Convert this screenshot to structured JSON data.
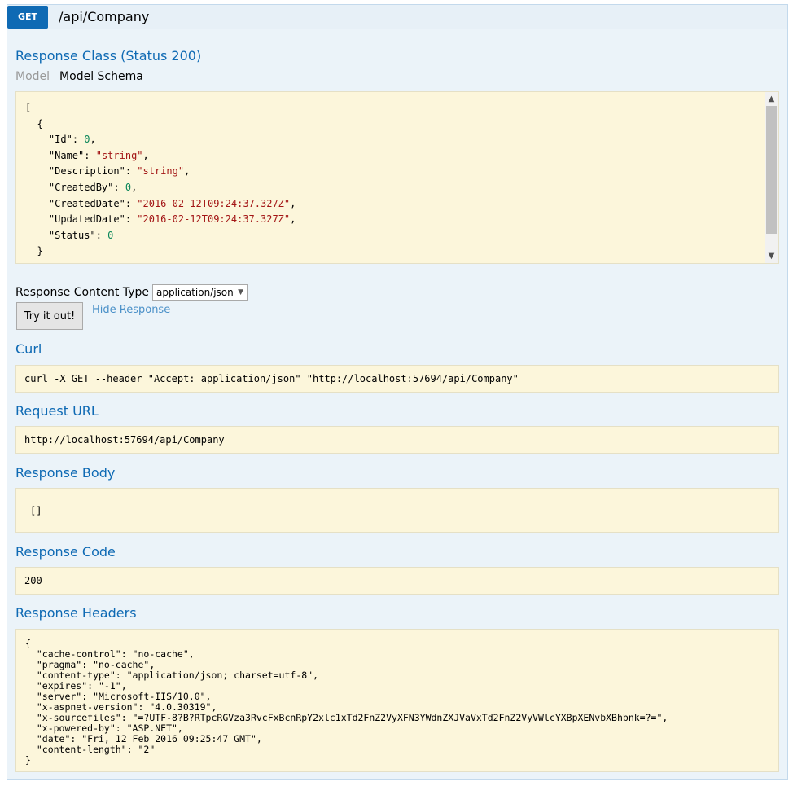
{
  "operation": {
    "method": "GET",
    "path": "/api/Company"
  },
  "response_class": {
    "title": "Response Class (Status 200)",
    "tabs": {
      "model": "Model",
      "schema": "Model Schema"
    },
    "schema_lines": [
      {
        "indent": 0,
        "key": "",
        "value": "[",
        "type": "punct",
        "trail": ""
      },
      {
        "indent": 1,
        "key": "",
        "value": "{",
        "type": "punct",
        "trail": ""
      },
      {
        "indent": 2,
        "key": "\"Id\"",
        "value": "0",
        "type": "num",
        "trail": ","
      },
      {
        "indent": 2,
        "key": "\"Name\"",
        "value": "\"string\"",
        "type": "str",
        "trail": ","
      },
      {
        "indent": 2,
        "key": "\"Description\"",
        "value": "\"string\"",
        "type": "str",
        "trail": ","
      },
      {
        "indent": 2,
        "key": "\"CreatedBy\"",
        "value": "0",
        "type": "num",
        "trail": ","
      },
      {
        "indent": 2,
        "key": "\"CreatedDate\"",
        "value": "\"2016-02-12T09:24:37.327Z\"",
        "type": "str",
        "trail": ","
      },
      {
        "indent": 2,
        "key": "\"UpdatedDate\"",
        "value": "\"2016-02-12T09:24:37.327Z\"",
        "type": "str",
        "trail": ","
      },
      {
        "indent": 2,
        "key": "\"Status\"",
        "value": "0",
        "type": "num",
        "trail": ""
      },
      {
        "indent": 1,
        "key": "",
        "value": "}",
        "type": "punct",
        "trail": ""
      }
    ]
  },
  "content_type": {
    "label": "Response Content Type",
    "selected": "application/json"
  },
  "actions": {
    "try_label": "Try it out!",
    "hide_label": "Hide Response"
  },
  "curl": {
    "title": "Curl",
    "value": "curl -X GET --header \"Accept: application/json\" \"http://localhost:57694/api/Company\""
  },
  "request_url": {
    "title": "Request URL",
    "value": "http://localhost:57694/api/Company"
  },
  "response_body": {
    "title": "Response Body",
    "value": "[]"
  },
  "response_code": {
    "title": "Response Code",
    "value": "200"
  },
  "response_headers": {
    "title": "Response Headers",
    "text": "{\n  \"cache-control\": \"no-cache\",\n  \"pragma\": \"no-cache\",\n  \"content-type\": \"application/json; charset=utf-8\",\n  \"expires\": \"-1\",\n  \"server\": \"Microsoft-IIS/10.0\",\n  \"x-aspnet-version\": \"4.0.30319\",\n  \"x-sourcefiles\": \"=?UTF-8?B?RTpcRGVza3RvcFxBcnRpY2xlc1xTd2FnZ2VyXFN3YWdnZXJVaVxTd2FnZ2VyVWlcYXBpXENvbXBhbnk=?=\",\n  \"x-powered-by\": \"ASP.NET\",\n  \"date\": \"Fri, 12 Feb 2016 09:25:47 GMT\",\n  \"content-length\": \"2\"\n}"
  },
  "icons": {
    "scroll_up": "chevron-up-icon",
    "scroll_down": "chevron-down-icon",
    "select_caret": "chevron-down-icon"
  },
  "colors": {
    "accent": "#0f6ab4",
    "panel_bg": "#ebf3f9",
    "code_bg": "#fcf6db",
    "string": "#a31515",
    "number": "#098658"
  }
}
